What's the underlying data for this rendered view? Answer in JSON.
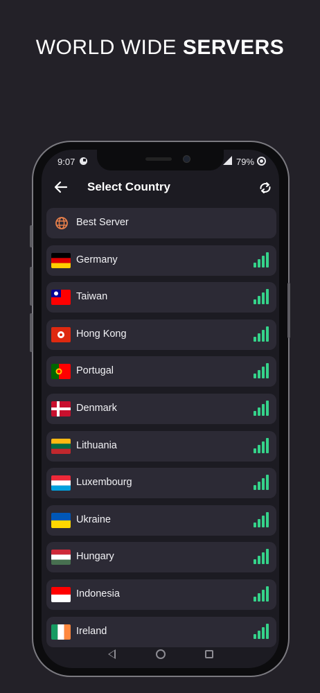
{
  "headline": {
    "light": "WORLD WIDE",
    "bold": "SERVERS"
  },
  "status_bar": {
    "time": "9:07",
    "battery": "79%"
  },
  "appbar": {
    "title": "Select Country",
    "back_icon": "arrow-left-icon",
    "refresh_icon": "refresh-icon"
  },
  "best_server": {
    "label": "Best Server",
    "icon": "globe-icon",
    "icon_color": "#e9804a"
  },
  "colors": {
    "background": "#232128",
    "row": "#2c2a35",
    "signal": "#35d38a"
  },
  "countries": [
    {
      "name": "Germany",
      "signal_bars": 4
    },
    {
      "name": "Taiwan",
      "signal_bars": 4
    },
    {
      "name": "Hong Kong",
      "signal_bars": 4
    },
    {
      "name": "Portugal",
      "signal_bars": 4
    },
    {
      "name": "Denmark",
      "signal_bars": 4
    },
    {
      "name": "Lithuania",
      "signal_bars": 4
    },
    {
      "name": "Luxembourg",
      "signal_bars": 4
    },
    {
      "name": "Ukraine",
      "signal_bars": 4
    },
    {
      "name": "Hungary",
      "signal_bars": 4
    },
    {
      "name": "Indonesia",
      "signal_bars": 4
    },
    {
      "name": "Ireland",
      "signal_bars": 4
    }
  ]
}
